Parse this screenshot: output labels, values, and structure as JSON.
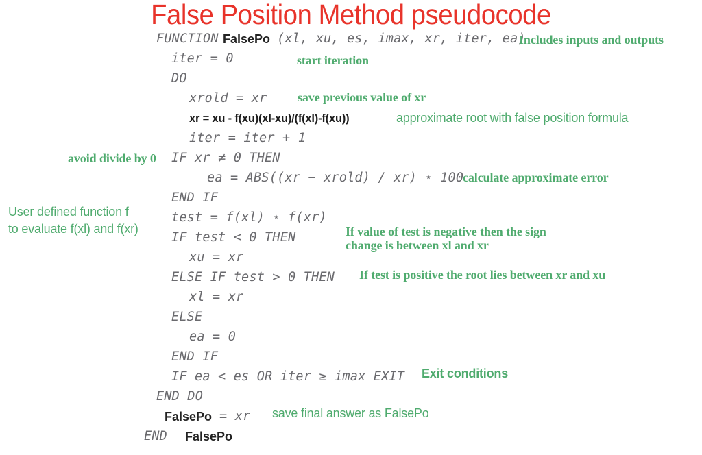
{
  "title": "False Position Method pseudocode",
  "colors": {
    "title_red": "#e8332a",
    "annotation_green": "#4fab6e",
    "code_gray": "#6a6a6e",
    "code_black": "#232323",
    "background": "#ffffff"
  },
  "code": {
    "l01_kw": "FUNCTION",
    "l01_name": "FalsePo",
    "l01_args": "(xl, xu, es, imax, xr, iter, ea)",
    "l02": "iter = 0",
    "l03": "DO",
    "l04": "xrold = xr",
    "l05": "xr = xu - f(xu)(xl-xu)/(f(xl)-f(xu))",
    "l06": "iter = iter + 1",
    "l07": "IF xr ≠ 0 THEN",
    "l08": "ea = ABS((xr − xrold) / xr) ⋆ 100",
    "l09": "END IF",
    "l10": "test = f(xl) ⋆ f(xr)",
    "l11": "IF test < 0 THEN",
    "l12": "xu = xr",
    "l13": "ELSE IF test > 0 THEN",
    "l14": "xl = xr",
    "l15": "ELSE",
    "l16": "ea = 0",
    "l17": "END IF",
    "l18": "IF ea < es OR iter ≥ imax EXIT",
    "l19": "END DO",
    "l20_name": "FalsePo",
    "l20_rest": "= xr",
    "l21_kw": "END",
    "l21_name": "FalsePo"
  },
  "annotations": {
    "includes_io": "Includes inputs and outputs",
    "start_iteration": "start iteration",
    "save_previous": "save previous value of xr",
    "approximate_root": "approximate root with false position formula",
    "avoid_divide": "avoid divide by 0",
    "calculate_error": "calculate approximate error",
    "user_function_l1": "User defined function f",
    "user_function_l2": "to evaluate f(xl) and f(xr)",
    "test_negative_l1": "If value of test is negative then the sign",
    "test_negative_l2": "change is between xl and xr",
    "test_positive": "If test is positive the root lies between xr and xu",
    "exit_conditions": "Exit conditions",
    "save_final_pre": "save final answer as ",
    "save_final_name": "FalsePo"
  }
}
